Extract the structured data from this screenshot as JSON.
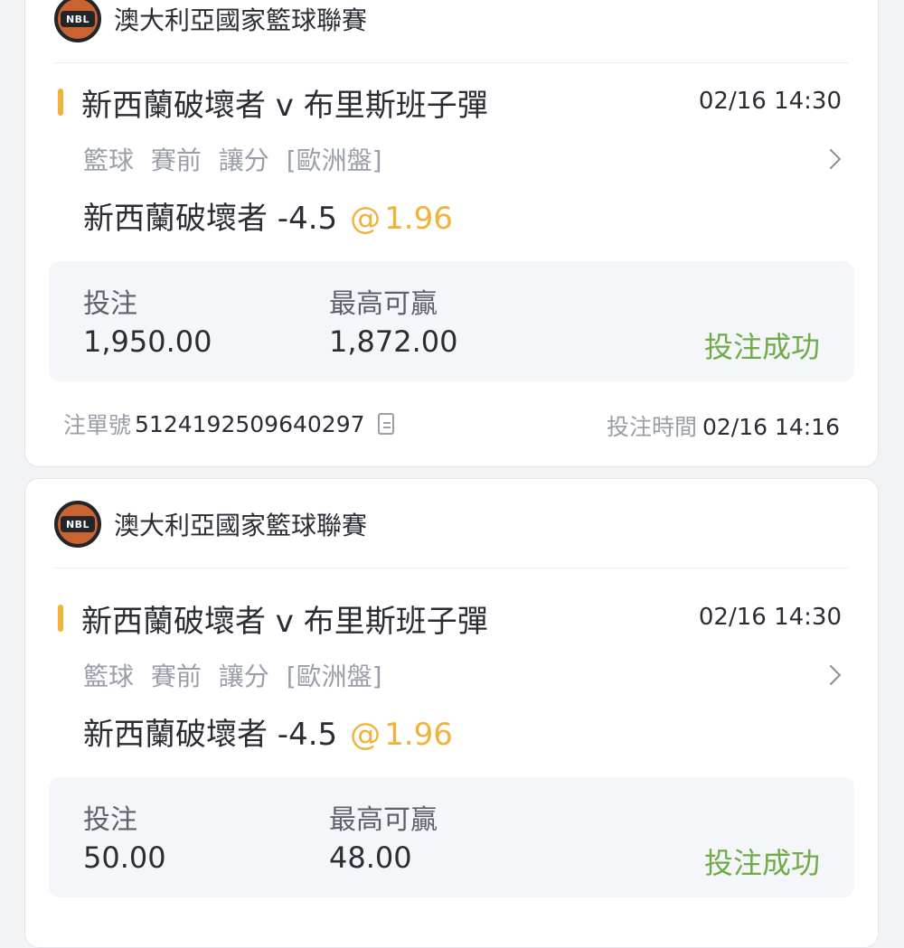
{
  "bets": [
    {
      "league": {
        "name": "澳大利亞國家籃球聯賽",
        "logo_text": "NBL",
        "icon": "nbl-logo"
      },
      "match": {
        "title": "新西蘭破壞者 v 布里斯班子彈",
        "time": "02/16 14:30",
        "meta": "籃球 賽前  讓分 [歐洲盤]",
        "selection": "新西蘭破壞者 -4.5",
        "odds_at": "@",
        "odds": "1.96"
      },
      "stake": {
        "stake_label": "投注",
        "stake_value": "1,950.00",
        "max_win_label": "最高可贏",
        "max_win_value": "1,872.00",
        "status": "投注成功"
      },
      "footer": {
        "ticket_label": "注單號",
        "ticket_number": "5124192509640297",
        "bet_time_label": "投注時間",
        "bet_time": "02/16 14:16"
      }
    },
    {
      "league": {
        "name": "澳大利亞國家籃球聯賽",
        "logo_text": "NBL",
        "icon": "nbl-logo"
      },
      "match": {
        "title": "新西蘭破壞者 v 布里斯班子彈",
        "time": "02/16 14:30",
        "meta": "籃球 賽前  讓分 [歐洲盤]",
        "selection": "新西蘭破壞者 -4.5",
        "odds_at": "@",
        "odds": "1.96"
      },
      "stake": {
        "stake_label": "投注",
        "stake_value": "50.00",
        "max_win_label": "最高可贏",
        "max_win_value": "48.00",
        "status": "投注成功"
      }
    }
  ],
  "colors": {
    "accent": "#f0b23a",
    "success": "#6fab46",
    "text": "#2a2d34",
    "muted": "#9a9ea8"
  }
}
